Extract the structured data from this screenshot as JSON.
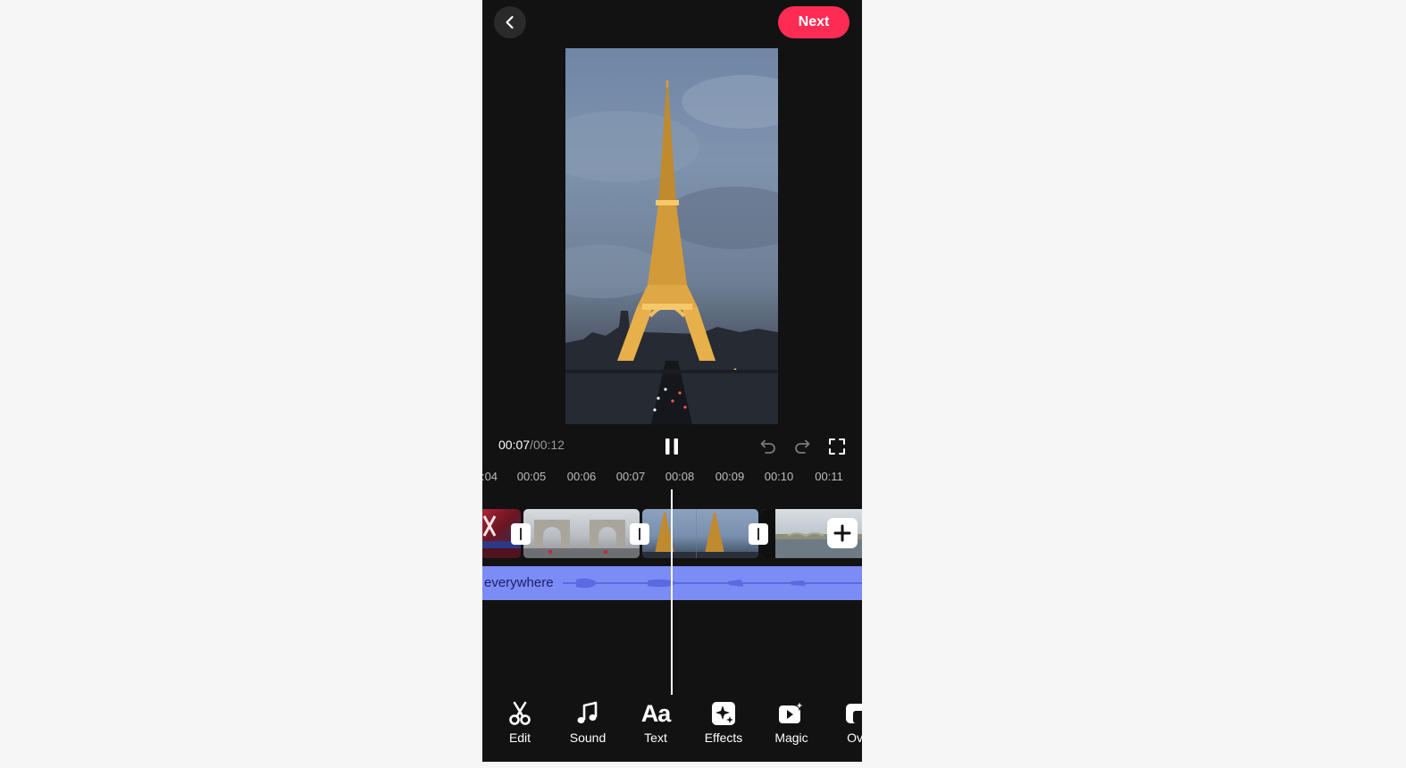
{
  "header": {
    "back_icon": "chevron-left-icon",
    "next_label": "Next"
  },
  "player": {
    "current_time": "00:07",
    "separator": "/",
    "total_time": "00:12",
    "state": "playing"
  },
  "ruler": {
    "ticks": [
      ":04",
      "00:05",
      "00:06",
      "00:07",
      "00:08",
      "00:09",
      "00:10",
      "00:11"
    ]
  },
  "audio": {
    "label": "everywhere"
  },
  "toolbar": {
    "items": [
      {
        "label": "Edit",
        "icon": "scissors-icon"
      },
      {
        "label": "Sound",
        "icon": "music-note-icon"
      },
      {
        "label": "Text",
        "icon": "text-aa-icon"
      },
      {
        "label": "Effects",
        "icon": "sparkle-effects-icon"
      },
      {
        "label": "Magic",
        "icon": "magic-video-icon"
      },
      {
        "label": "Ove",
        "icon": "overlay-icon"
      }
    ]
  },
  "colors": {
    "accent": "#fe2c55",
    "audio_track": "#7b8cf5",
    "background": "#121212",
    "page": "#f6f6f6"
  }
}
